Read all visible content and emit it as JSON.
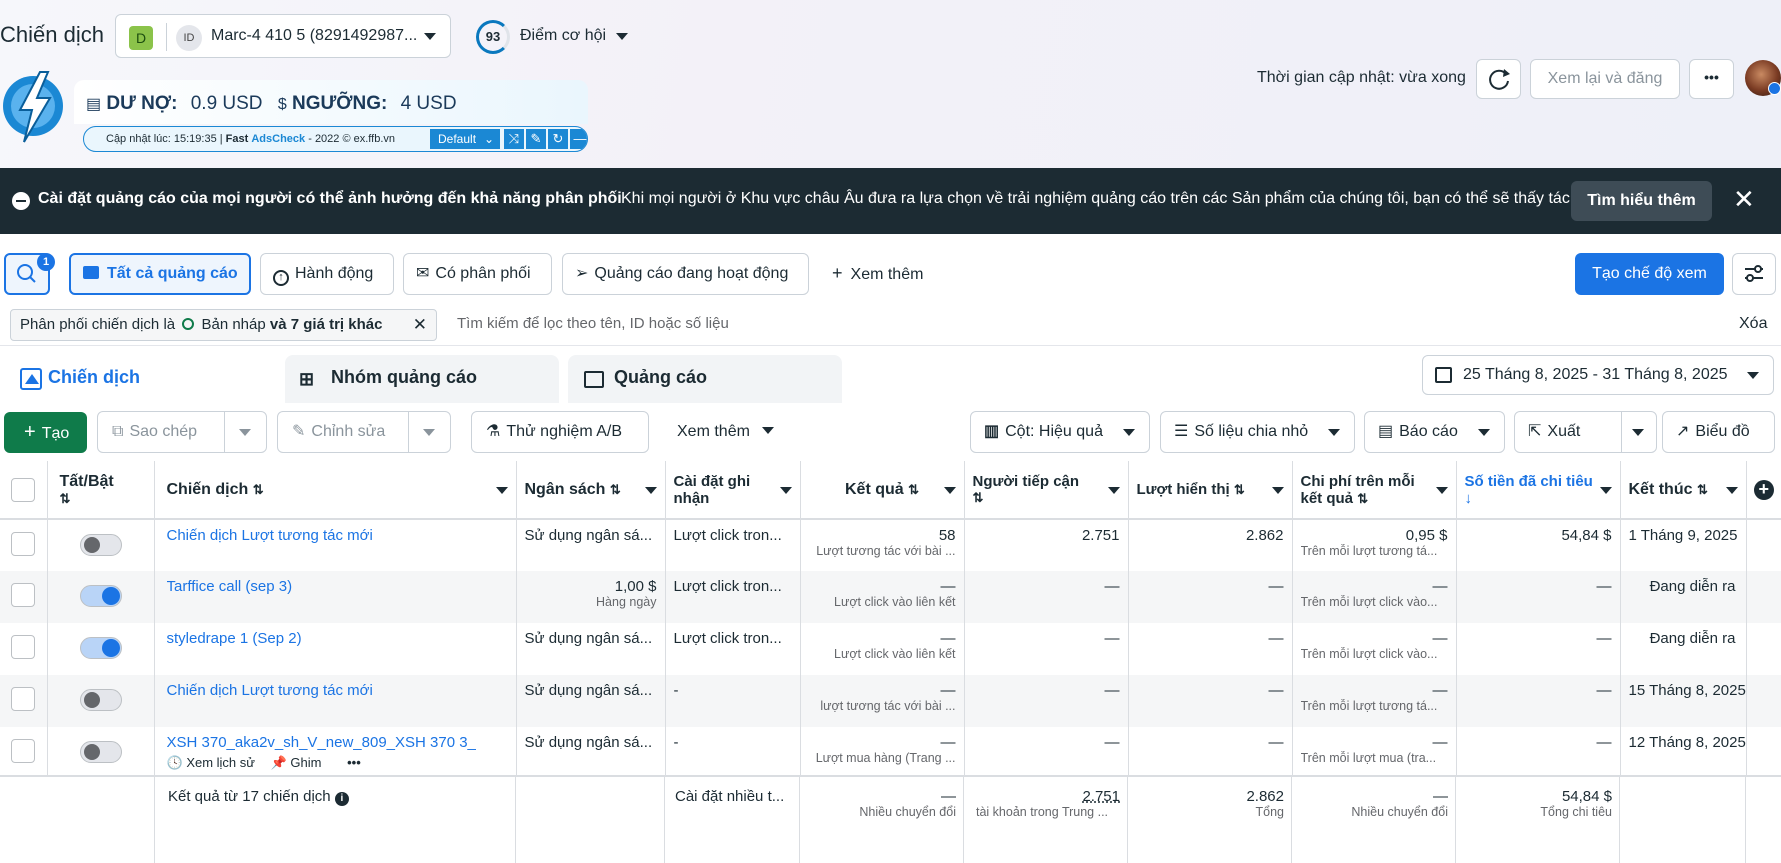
{
  "header": {
    "title": "Chiến dịch",
    "account": {
      "initial": "D",
      "avatar_text": "ID",
      "name": "Marc-4 410 5 (8291492987..."
    },
    "opportunity": {
      "score": "93",
      "label": "Điểm cơ hội"
    },
    "update_time": "Thời gian cập nhật: vừa xong",
    "review_publish": "Xem lại và đăng",
    "more": "•••"
  },
  "fast_ads": {
    "debt_label": "DƯ NỢ:",
    "debt_value": "0.9 USD",
    "threshold_label": "NGƯỠNG:",
    "threshold_value": "4 USD",
    "updated": "Cập nhật lúc: 15:19:35 |",
    "brand_a": "Fast",
    "brand_b": "AdsCheck",
    "footer": "- 2022 © ex.ffb.vn",
    "mode": "Default"
  },
  "notice": {
    "bold": "Cài đặt quảng cáo của mọi người có thể ảnh hưởng đến khả năng phân phối",
    "message": "Khi mọi người ở Khu vực châu Âu đưa ra lựa chọn về trải nghiệm quảng cáo trên các Sản phẩm của chúng tôi, bạn có thể sẽ thấy tác...",
    "learn_more": "Tìm hiểu thêm"
  },
  "toolbar1": {
    "search_badge": "1",
    "all_ads": "Tất cả quảng cáo",
    "actions": "Hành động",
    "has_delivery": "Có phân phối",
    "active_ads": "Quảng cáo đang hoạt động",
    "see_more": "Xem thêm",
    "create_view": "Tạo chế độ xem"
  },
  "filter": {
    "chip_prefix": "Phân phối chiến dịch là",
    "chip_value": "Bản nháp",
    "chip_more": "và 7 giá trị khác",
    "search_placeholder": "Tìm kiếm để lọc theo tên, ID hoặc số liệu",
    "clear": "Xóa"
  },
  "tabs": {
    "campaigns": "Chiến dịch",
    "ad_sets": "Nhóm quảng cáo",
    "ads": "Quảng cáo",
    "date_range": "25 Tháng 8, 2025 - 31 Tháng 8, 2025"
  },
  "toolbar2": {
    "create": "Tạo",
    "copy": "Sao chép",
    "edit": "Chỉnh sửa",
    "ab_test": "Thử nghiệm A/B",
    "see_more": "Xem thêm",
    "columns": "Cột: Hiệu quả",
    "breakdown": "Số liệu chia nhỏ",
    "reports": "Báo cáo",
    "export": "Xuất",
    "charts": "Biểu đồ"
  },
  "table": {
    "headers": {
      "toggle": "Tất/Bật",
      "campaign": "Chiến dịch",
      "budget": "Ngân sách",
      "attribution": "Cài đặt ghi nhận",
      "results": "Kết quả",
      "reach": "Người tiếp cận",
      "impressions": "Lượt hiển thị",
      "cost": "Chi phí trên mỗi kết quả",
      "spent": "Số tiền đã chi tiêu",
      "end": "Kết thúc"
    },
    "rows": [
      {
        "on": false,
        "name": "Chiến dịch Lượt tương tác mới",
        "budget": "Sử dụng ngân sá...",
        "budget_sub": "",
        "attr": "Lượt click tron...",
        "result": "58",
        "result_sub": "Lượt tương tác với bài ...",
        "reach": "2.751",
        "impr": "2.862",
        "cost": "0,95 $",
        "cost_sub": "Trên mỗi lượt tương tá...",
        "spent": "54,84 $",
        "end": "1 Tháng 9, 2025"
      },
      {
        "on": true,
        "name": "Tarffice call (sep 3)",
        "budget": "1,00 $",
        "budget_sub": "Hàng ngày",
        "attr": "Lượt click tron...",
        "result": "—",
        "result_sub": "Lượt click vào liên kết",
        "reach": "—",
        "impr": "—",
        "cost": "—",
        "cost_sub": "Trên mỗi lượt click vào...",
        "spent": "—",
        "end": "Đang diễn ra"
      },
      {
        "on": true,
        "name": "styledrape 1 (Sep 2)",
        "budget": "Sử dụng ngân sá...",
        "budget_sub": "",
        "attr": "Lượt click tron...",
        "result": "—",
        "result_sub": "Lượt click vào liên kết",
        "reach": "—",
        "impr": "—",
        "cost": "—",
        "cost_sub": "Trên mỗi lượt click vào...",
        "spent": "—",
        "end": "Đang diễn ra"
      },
      {
        "on": false,
        "name": "Chiến dịch Lượt tương tác mới",
        "budget": "Sử dụng ngân sá...",
        "budget_sub": "",
        "attr": "-",
        "result": "—",
        "result_sub": "lượt tương tác với bài ...",
        "reach": "—",
        "impr": "—",
        "cost": "—",
        "cost_sub": "Trên mỗi lượt tương tá...",
        "spent": "—",
        "end": "15 Tháng 8, 2025"
      },
      {
        "on": false,
        "name": "XSH 370_aka2v_sh_V_new_809_XSH 370 3_",
        "budget": "Sử dụng ngân sá...",
        "budget_sub": "",
        "attr": "-",
        "result": "—",
        "result_sub": "Lượt mua hàng (Trang ...",
        "reach": "—",
        "impr": "—",
        "cost": "—",
        "cost_sub": "Trên mỗi lượt mua (tra...",
        "spent": "—",
        "end": "12 Tháng 8, 2025"
      }
    ],
    "row_actions": {
      "history": "Xem lịch sử",
      "pin": "Ghim",
      "more": "•••"
    },
    "summary": {
      "label": "Kết quả từ 17 chiến dịch",
      "attr": "Cài đặt nhiều t...",
      "result": "—",
      "result_sub": "Nhiều chuyển đổi",
      "reach": "2.751",
      "reach_sub": "tài khoản trong Trung ...",
      "impr": "2.862",
      "impr_sub": "Tổng",
      "cost": "—",
      "cost_sub": "Nhiều chuyển đổi",
      "spent": "54,84 $",
      "spent_sub": "Tổng chi tiêu"
    }
  },
  "colors": {
    "accent": "#1b74e4",
    "create": "#0f7b4a",
    "dark": "#1c2b33",
    "fast_blue": "#1b88d4"
  }
}
